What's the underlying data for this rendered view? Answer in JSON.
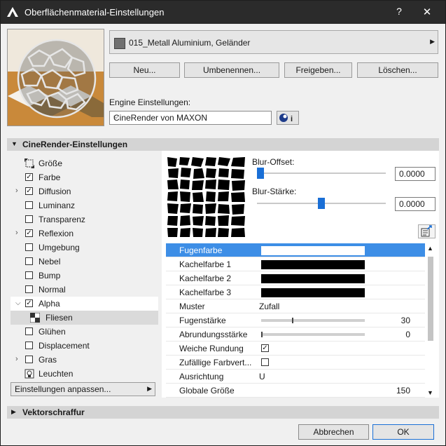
{
  "window": {
    "title": "Oberflächenmaterial-Einstellungen",
    "help": "?",
    "close": "✕"
  },
  "material": {
    "name": "015_Metall Aluminium, Geländer",
    "swatch_color": "#707070"
  },
  "buttons": {
    "new": "Neu...",
    "rename": "Umbenennen...",
    "share": "Freigeben...",
    "delete": "Löschen..."
  },
  "engine": {
    "label": "Engine Einstellungen:",
    "value": "CineRender von MAXON"
  },
  "sections": {
    "cinerender": "CineRender-Einstellungen",
    "vector": "Vektorschraffur"
  },
  "channels": [
    {
      "label": "Größe",
      "checkbox": false,
      "expand": false,
      "checked": false,
      "icon": "size-icon"
    },
    {
      "label": "Farbe",
      "checkbox": true,
      "expand": false,
      "checked": true
    },
    {
      "label": "Diffusion",
      "checkbox": true,
      "expand": true,
      "expanded": false,
      "checked": true
    },
    {
      "label": "Luminanz",
      "checkbox": true,
      "expand": false,
      "checked": false
    },
    {
      "label": "Transparenz",
      "checkbox": true,
      "expand": false,
      "checked": false
    },
    {
      "label": "Reflexion",
      "checkbox": true,
      "expand": true,
      "expanded": false,
      "checked": true
    },
    {
      "label": "Umgebung",
      "checkbox": true,
      "expand": false,
      "checked": false
    },
    {
      "label": "Nebel",
      "checkbox": true,
      "expand": false,
      "checked": false
    },
    {
      "label": "Bump",
      "checkbox": true,
      "expand": false,
      "checked": false
    },
    {
      "label": "Normal",
      "checkbox": true,
      "expand": false,
      "checked": false
    },
    {
      "label": "Alpha",
      "checkbox": true,
      "expand": true,
      "expanded": true,
      "checked": true
    },
    {
      "label": "Fliesen",
      "checkbox": false,
      "expand": false,
      "checked": false,
      "icon": "tile-icon",
      "child": true
    },
    {
      "label": "Glühen",
      "checkbox": true,
      "expand": false,
      "checked": false
    },
    {
      "label": "Displacement",
      "checkbox": true,
      "expand": false,
      "checked": false
    },
    {
      "label": "Gras",
      "checkbox": true,
      "expand": true,
      "expanded": false,
      "checked": false
    },
    {
      "label": "Leuchten",
      "checkbox": false,
      "expand": false,
      "checked": false,
      "icon": "light-icon"
    }
  ],
  "settings_button": "Einstellungen anpassen...",
  "blur": {
    "offset_label": "Blur-Offset:",
    "offset_value": "0.0000",
    "offset_level": 0.0,
    "strength_label": "Blur-Stärke:",
    "strength_value": "0.0000",
    "strength_level": 0.5
  },
  "properties": [
    {
      "key": "Fugenfarbe",
      "type": "color",
      "color": "#ffffff"
    },
    {
      "key": "Kachelfarbe 1",
      "type": "color",
      "color": "#000000"
    },
    {
      "key": "Kachelfarbe 2",
      "type": "color",
      "color": "#000000"
    },
    {
      "key": "Kachelfarbe 3",
      "type": "color",
      "color": "#000000"
    },
    {
      "key": "Muster",
      "type": "text",
      "value": "Zufall"
    },
    {
      "key": "Fugenstärke",
      "type": "slider",
      "value": "30",
      "level": 0.3
    },
    {
      "key": "Abrundungsstärke",
      "type": "slider",
      "value": "0",
      "level": 0.0
    },
    {
      "key": "Weiche Rundung",
      "type": "check",
      "checked": true
    },
    {
      "key": "Zufällige Farbvert...",
      "type": "check",
      "checked": false
    },
    {
      "key": "Ausrichtung",
      "type": "text",
      "value": "U"
    },
    {
      "key": "Globale Größe",
      "type": "number",
      "value": "150"
    }
  ],
  "footer": {
    "cancel": "Abbrechen",
    "ok": "OK"
  },
  "colors": {
    "accent": "#3d8ee6",
    "slider_thumb": "#1a6fd6"
  }
}
